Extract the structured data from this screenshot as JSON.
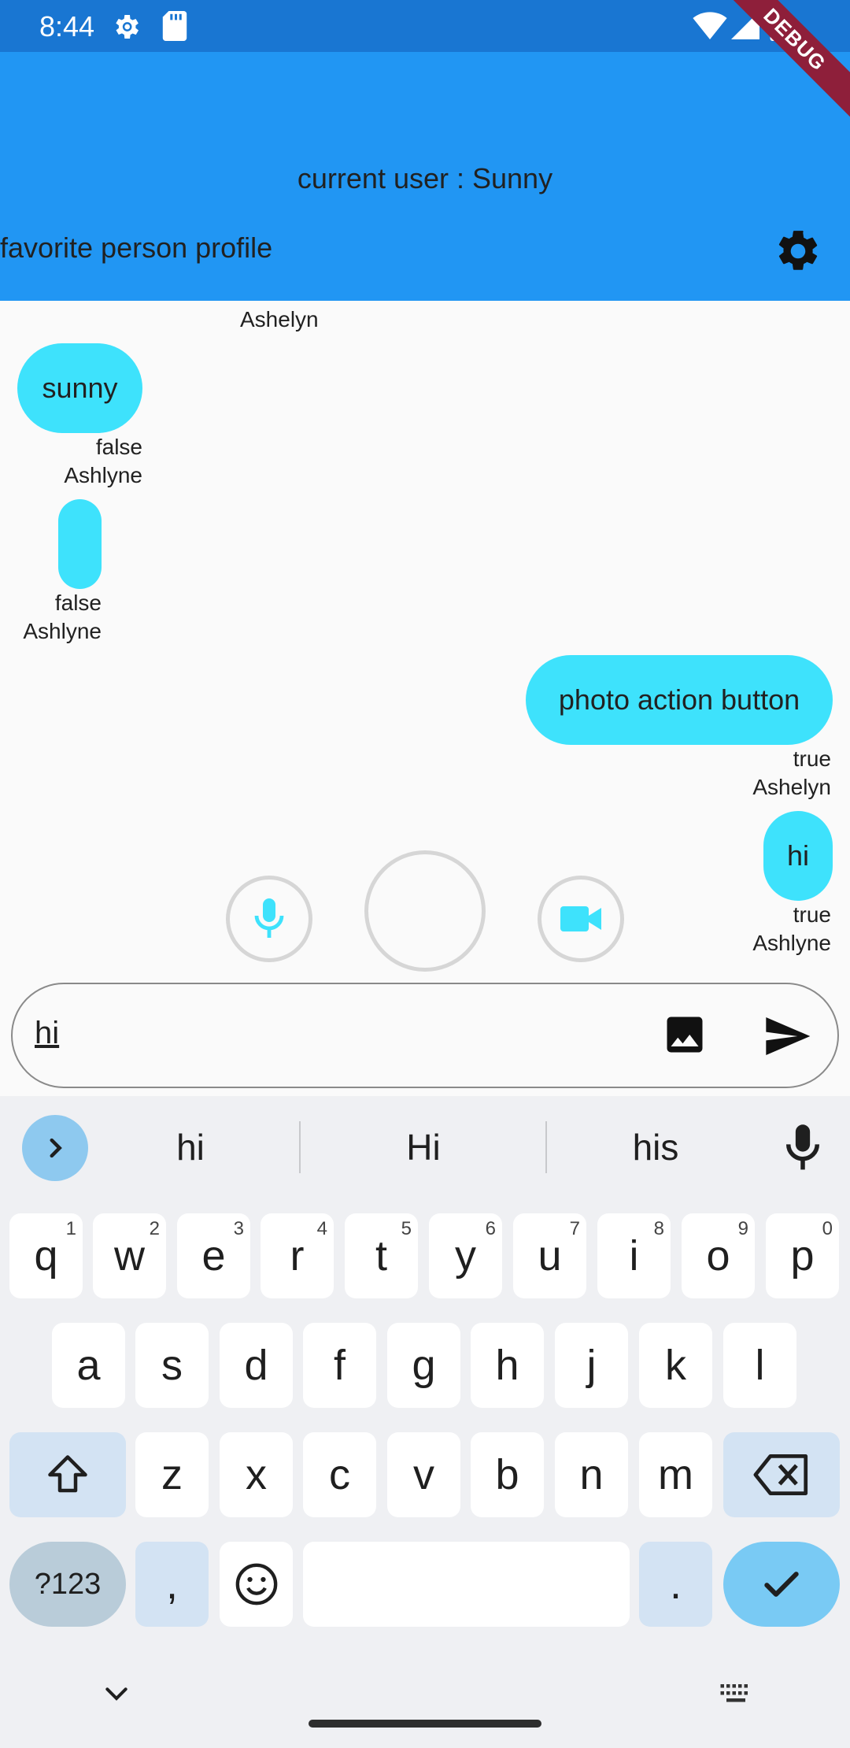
{
  "status_bar": {
    "time": "8:44"
  },
  "debug_banner": "DEBUG",
  "app_bar": {
    "current_user": "current user : Sunny",
    "favorite_profile": "favorite person profile"
  },
  "chat": {
    "top_name": "Ashelyn",
    "messages": [
      {
        "text": "sunny",
        "flag": "false",
        "name": "Ashlyne"
      },
      {
        "text": "",
        "flag": "false",
        "name": "Ashlyne"
      },
      {
        "text": "photo action button",
        "flag": "true",
        "name": "Ashelyn"
      },
      {
        "text": "hi",
        "flag": "true",
        "name": "Ashlyne"
      }
    ]
  },
  "input": {
    "value": "hi"
  },
  "keyboard": {
    "suggestions": [
      "hi",
      "Hi",
      "his"
    ],
    "row1": [
      {
        "k": "q",
        "h": "1"
      },
      {
        "k": "w",
        "h": "2"
      },
      {
        "k": "e",
        "h": "3"
      },
      {
        "k": "r",
        "h": "4"
      },
      {
        "k": "t",
        "h": "5"
      },
      {
        "k": "y",
        "h": "6"
      },
      {
        "k": "u",
        "h": "7"
      },
      {
        "k": "i",
        "h": "8"
      },
      {
        "k": "o",
        "h": "9"
      },
      {
        "k": "p",
        "h": "0"
      }
    ],
    "row2": [
      "a",
      "s",
      "d",
      "f",
      "g",
      "h",
      "j",
      "k",
      "l"
    ],
    "row3": [
      "z",
      "x",
      "c",
      "v",
      "b",
      "n",
      "m"
    ],
    "symbols_label": "?123",
    "comma": ",",
    "period": "."
  },
  "colors": {
    "status_bar": "#1976d2",
    "app_bar": "#2196f3",
    "bubble": "#3ee2fc",
    "accent": "#79caf4"
  }
}
